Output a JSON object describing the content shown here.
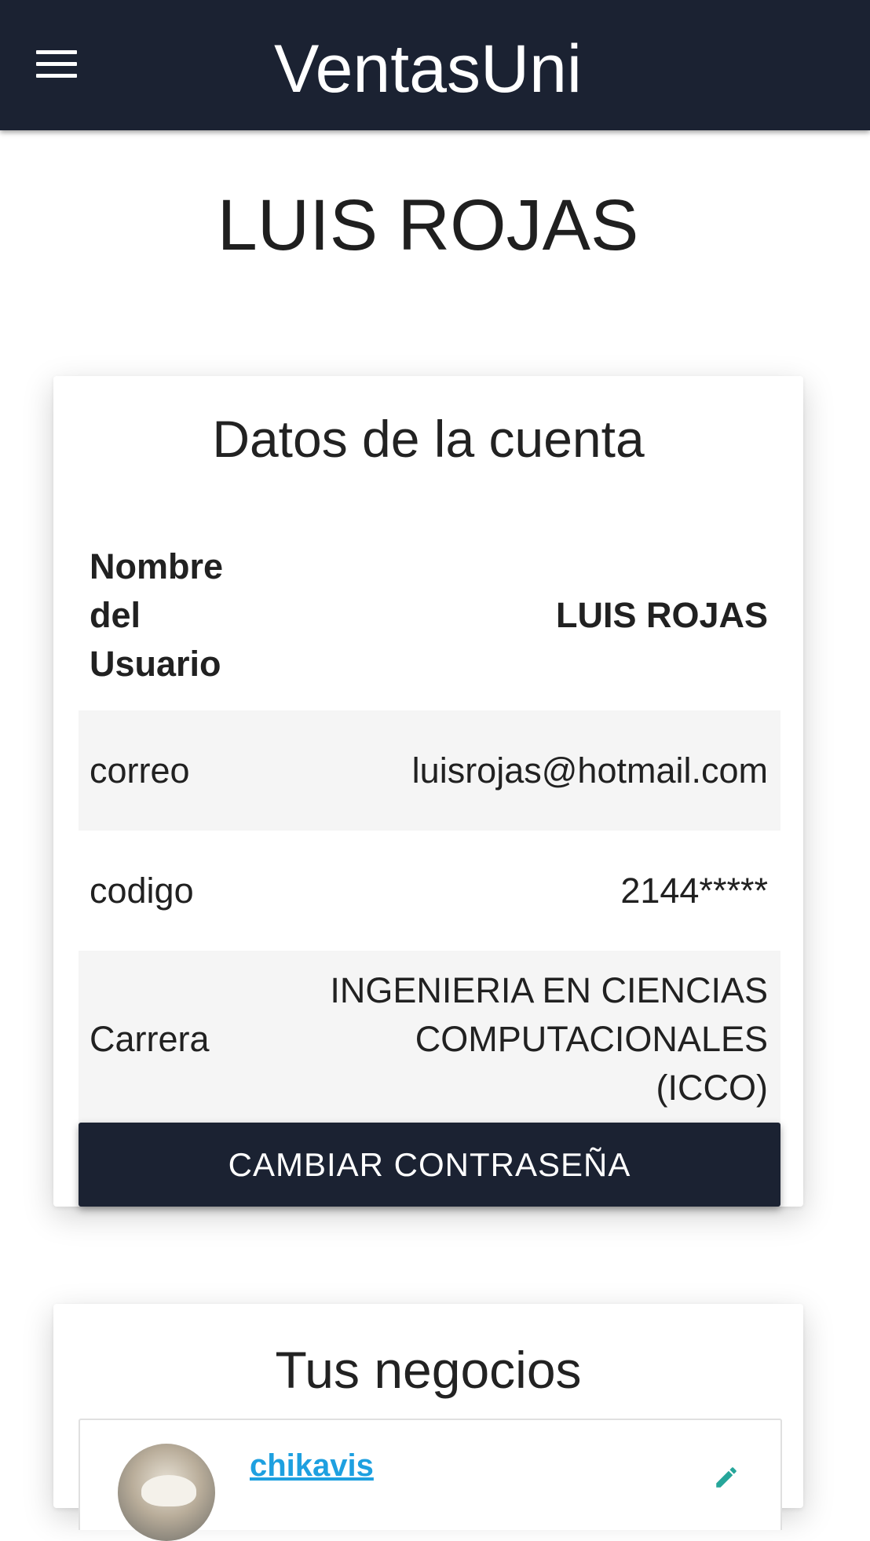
{
  "header": {
    "title": "VentasUni",
    "menu_icon": "hamburger-menu-icon"
  },
  "user_heading": "LUIS ROJAS",
  "account_card": {
    "title": "Datos de la cuenta",
    "rows": [
      {
        "label": "Nombre del Usuario",
        "value": "LUIS ROJAS"
      },
      {
        "label": "correo",
        "value": "luisrojas@hotmail.com"
      },
      {
        "label": "codigo",
        "value": "2144*****"
      },
      {
        "label": "Carrera",
        "value": "INGENIERIA EN CIENCIAS COMPUTACIONALES (ICCO)"
      }
    ],
    "change_password_label": "CAMBIAR CONTRASEÑA"
  },
  "business_card": {
    "title": "Tus negocios",
    "items": [
      {
        "name": "chikavis",
        "edit_icon": "pencil-edit-icon"
      }
    ]
  },
  "colors": {
    "appbar": "#1b2232",
    "link": "#1ea0e0",
    "edit_icon": "#26a69a"
  }
}
